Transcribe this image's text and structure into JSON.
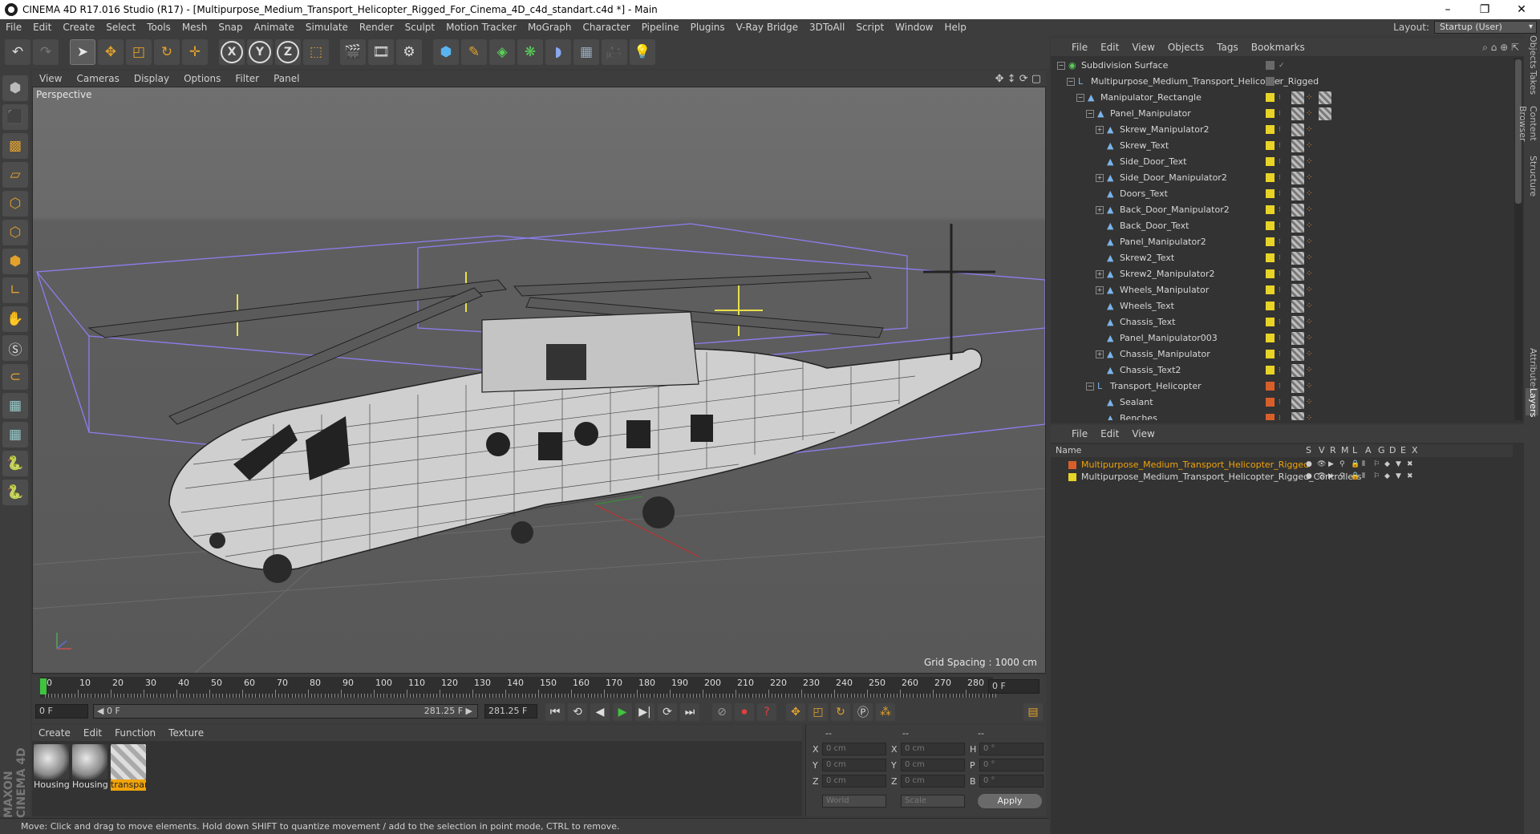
{
  "window": {
    "title": "CINEMA 4D R17.016 Studio (R17) - [Multipurpose_Medium_Transport_Helicopter_Rigged_For_Cinema_4D_c4d_standart.c4d *] - Main",
    "controls": {
      "minimize": "–",
      "maximize": "❐",
      "close": "✕"
    }
  },
  "menubar": {
    "items": [
      "File",
      "Edit",
      "Create",
      "Select",
      "Tools",
      "Mesh",
      "Snap",
      "Animate",
      "Simulate",
      "Render",
      "Sculpt",
      "Motion Tracker",
      "MoGraph",
      "Character",
      "Pipeline",
      "Plugins",
      "V-Ray Bridge",
      "3DToAll",
      "Script",
      "Window",
      "Help"
    ],
    "layout_label": "Layout:",
    "layout_value": "Startup (User)"
  },
  "toolbar": {
    "icons": [
      "undo-icon",
      "redo-icon",
      "select-arrow-icon",
      "move-icon",
      "scale-icon",
      "rotate-icon",
      "live-selection-icon",
      "x-axis-icon",
      "y-axis-icon",
      "z-axis-icon",
      "coordinate-system-icon",
      "render-view-icon",
      "render-picture-viewer-icon",
      "edit-render-settings-icon",
      "cube-icon",
      "pen-icon",
      "subdivision-icon",
      "array-icon",
      "deformer-icon",
      "floor-icon",
      "camera-icon",
      "light-icon"
    ],
    "axis_x": "X",
    "axis_y": "Y",
    "axis_z": "Z"
  },
  "viewport": {
    "menu": [
      "View",
      "Cameras",
      "Display",
      "Options",
      "Filter",
      "Panel"
    ],
    "label": "Perspective",
    "grid_spacing": "Grid Spacing : 1000 cm"
  },
  "timeline": {
    "ticks": [
      "0",
      "10",
      "20",
      "30",
      "40",
      "50",
      "60",
      "70",
      "80",
      "90",
      "100",
      "110",
      "120",
      "130",
      "140",
      "150",
      "160",
      "170",
      "180",
      "190",
      "200",
      "210",
      "220",
      "230",
      "240",
      "250",
      "260",
      "270",
      "280"
    ],
    "current_frame": "0 F",
    "start_field": "0 F",
    "range_start": "◀ 0 F",
    "range_end": "281.25 F ▶",
    "end_field": "281.25 F"
  },
  "material_manager": {
    "menu": [
      "Create",
      "Edit",
      "Function",
      "Texture"
    ],
    "materials": [
      {
        "name": "Housing",
        "selected": false
      },
      {
        "name": "Housing",
        "selected": false
      },
      {
        "name": "transpar",
        "selected": true
      }
    ]
  },
  "coordinates": {
    "header": [
      "--",
      "--",
      "--"
    ],
    "rows": [
      {
        "a": "X",
        "av": "0 cm",
        "b": "X",
        "bv": "0 cm",
        "c": "H",
        "cv": "0 °"
      },
      {
        "a": "Y",
        "av": "0 cm",
        "b": "Y",
        "bv": "0 cm",
        "c": "P",
        "cv": "0 °"
      },
      {
        "a": "Z",
        "av": "0 cm",
        "b": "Z",
        "bv": "0 cm",
        "c": "B",
        "cv": "0 °"
      }
    ],
    "world": "World",
    "scale": "Scale",
    "apply": "Apply"
  },
  "status": "Move: Click and drag to move elements. Hold down SHIFT to quantize movement / add to the selection in point mode, CTRL to remove.",
  "object_manager": {
    "menu": [
      "File",
      "Edit",
      "View",
      "Objects",
      "Tags",
      "Bookmarks"
    ],
    "rows": [
      {
        "name": "Subdivision Surface",
        "indent": 0,
        "color": "#6a6a6a",
        "expand": "−"
      },
      {
        "name": "Multipurpose_Medium_Transport_Helicopter_Rigged",
        "indent": 1,
        "color": "#6a6a6a",
        "expand": "−"
      },
      {
        "name": "Manipulator_Rectangle",
        "indent": 2,
        "color": "#e8d327",
        "expand": "−"
      },
      {
        "name": "Panel_Manipulator",
        "indent": 3,
        "color": "#e8d327",
        "expand": "−"
      },
      {
        "name": "Skrew_Manipulator2",
        "indent": 4,
        "color": "#e8d327",
        "expand": "+"
      },
      {
        "name": "Skrew_Text",
        "indent": 4,
        "color": "#e8d327",
        "expand": ""
      },
      {
        "name": "Side_Door_Text",
        "indent": 4,
        "color": "#e8d327",
        "expand": ""
      },
      {
        "name": "Side_Door_Manipulator2",
        "indent": 4,
        "color": "#e8d327",
        "expand": "+"
      },
      {
        "name": "Doors_Text",
        "indent": 4,
        "color": "#e8d327",
        "expand": ""
      },
      {
        "name": "Back_Door_Manipulator2",
        "indent": 4,
        "color": "#e8d327",
        "expand": "+"
      },
      {
        "name": "Back_Door_Text",
        "indent": 4,
        "color": "#e8d327",
        "expand": ""
      },
      {
        "name": "Panel_Manipulator2",
        "indent": 4,
        "color": "#e8d327",
        "expand": ""
      },
      {
        "name": "Skrew2_Text",
        "indent": 4,
        "color": "#e8d327",
        "expand": ""
      },
      {
        "name": "Skrew2_Manipulator2",
        "indent": 4,
        "color": "#e8d327",
        "expand": "+"
      },
      {
        "name": "Wheels_Manipulator",
        "indent": 4,
        "color": "#e8d327",
        "expand": "+"
      },
      {
        "name": "Wheels_Text",
        "indent": 4,
        "color": "#e8d327",
        "expand": ""
      },
      {
        "name": "Chassis_Text",
        "indent": 4,
        "color": "#e8d327",
        "expand": ""
      },
      {
        "name": "Panel_Manipulator003",
        "indent": 4,
        "color": "#e8d327",
        "expand": ""
      },
      {
        "name": "Chassis_Manipulator",
        "indent": 4,
        "color": "#e8d327",
        "expand": "+"
      },
      {
        "name": "Chassis_Text2",
        "indent": 4,
        "color": "#e8d327",
        "expand": ""
      },
      {
        "name": "Transport_Helicopter",
        "indent": 3,
        "color": "#d85f2a",
        "expand": "−"
      },
      {
        "name": "Sealant",
        "indent": 4,
        "color": "#d85f2a",
        "expand": ""
      },
      {
        "name": "Benches",
        "indent": 4,
        "color": "#d85f2a",
        "expand": ""
      }
    ]
  },
  "layer_manager": {
    "menu": [
      "File",
      "Edit",
      "View"
    ],
    "headers": [
      "Name",
      "S",
      "V",
      "R",
      "M",
      "L",
      "A",
      "G",
      "D",
      "E",
      "X"
    ],
    "rows": [
      {
        "name": "Multipurpose_Medium_Transport_Helicopter_Rigged",
        "color": "#d85f2a",
        "highlight": true
      },
      {
        "name": "Multipurpose_Medium_Transport_Helicopter_Rigged_Controllers",
        "color": "#e8d327",
        "highlight": false
      }
    ]
  },
  "right_tabs": [
    "Objects",
    "Takes",
    "Content Browser",
    "Structure",
    "Attributes",
    "Layers"
  ],
  "brand": "MAXON CINEMA 4D"
}
